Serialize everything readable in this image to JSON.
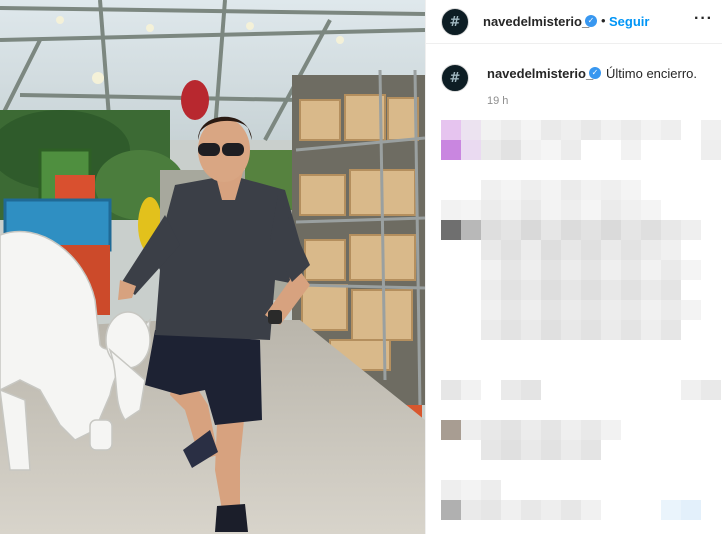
{
  "post": {
    "username": "navedelmisterio_",
    "follow_label": "Seguir",
    "separator": "•",
    "more_label": "···",
    "avatar_glyph": "#",
    "verified_glyph": "✓"
  },
  "caption": {
    "username": "navedelmisterio_",
    "text": "Último encierro.",
    "timestamp": "19 h"
  },
  "colors": {
    "accent": "#0095f6",
    "verified": "#3897f0",
    "avatar_bg": "#0d1d24"
  }
}
